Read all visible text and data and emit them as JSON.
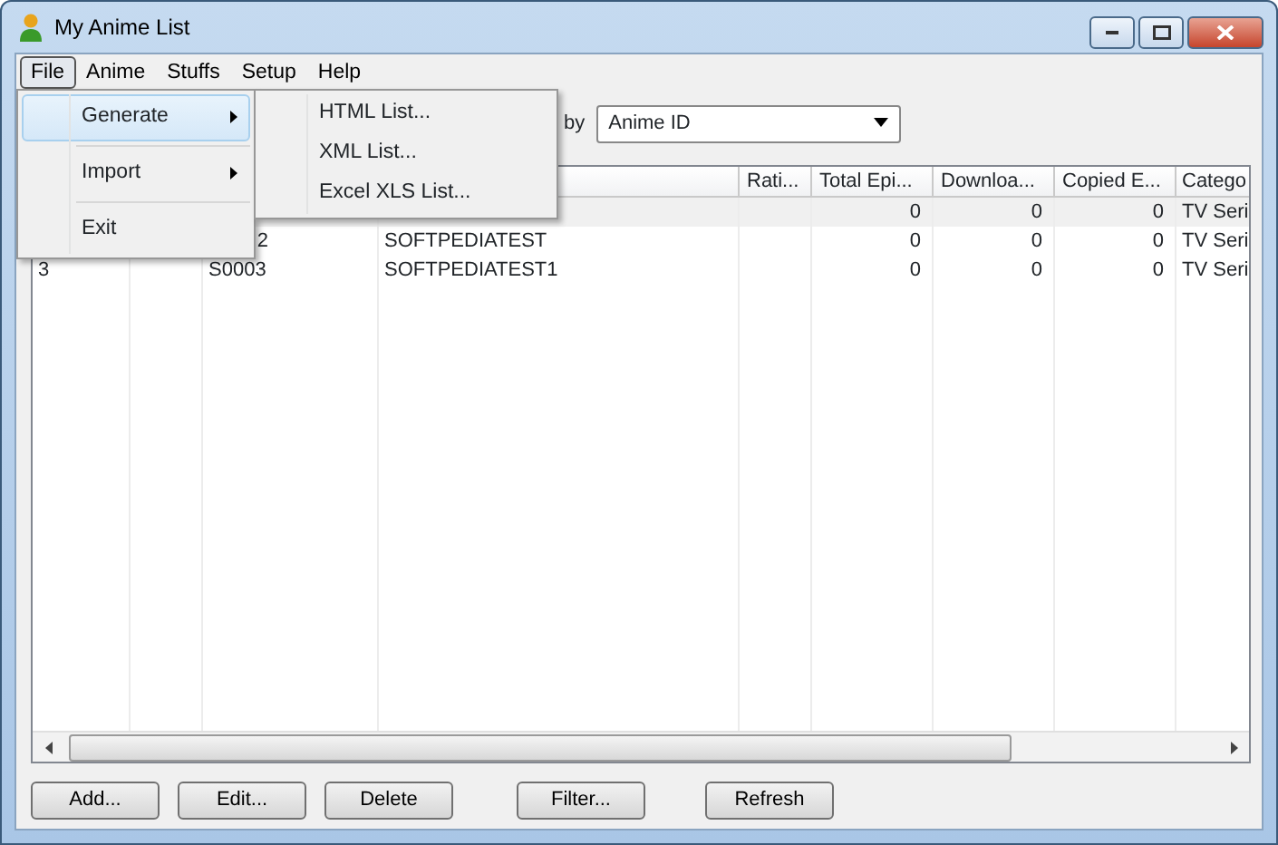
{
  "window": {
    "title": "My Anime List"
  },
  "menu_bar": [
    {
      "label": "File",
      "selected": true
    },
    {
      "label": "Anime",
      "selected": false
    },
    {
      "label": "Stuffs",
      "selected": false
    },
    {
      "label": "Setup",
      "selected": false
    },
    {
      "label": "Help",
      "selected": false
    }
  ],
  "file_menu": [
    {
      "label": "Generate",
      "submenu": true,
      "selected": true
    },
    {
      "label": "Import",
      "submenu": true,
      "selected": false
    },
    {
      "label": "Exit",
      "submenu": false,
      "selected": false
    }
  ],
  "generate_submenu": [
    "HTML List...",
    "XML List...",
    "Excel XLS List..."
  ],
  "sort": {
    "label": "by",
    "value": "Anime ID"
  },
  "table": {
    "columns": [
      null,
      null,
      null,
      "",
      "Rati...",
      "Total Epi...",
      "Downloa...",
      "Copied E...",
      "Catego"
    ],
    "rows": [
      {
        "selected": true,
        "cells": [
          null,
          null,
          null,
          null,
          null,
          "0",
          "0",
          "0",
          "TV Seri"
        ]
      },
      {
        "selected": false,
        "cells": [
          null,
          null,
          {
            "kind": "tail",
            "text": "2"
          },
          "SOFTPEDIATEST",
          null,
          "0",
          "0",
          "0",
          "TV Seri"
        ]
      },
      {
        "selected": false,
        "cells": [
          "3",
          null,
          "S0003",
          "SOFTPEDIATEST1",
          null,
          "0",
          "0",
          "0",
          "TV Seri"
        ]
      }
    ]
  },
  "buttons": [
    "Add...",
    "Edit...",
    "Delete",
    "Filter...",
    "Refresh"
  ]
}
